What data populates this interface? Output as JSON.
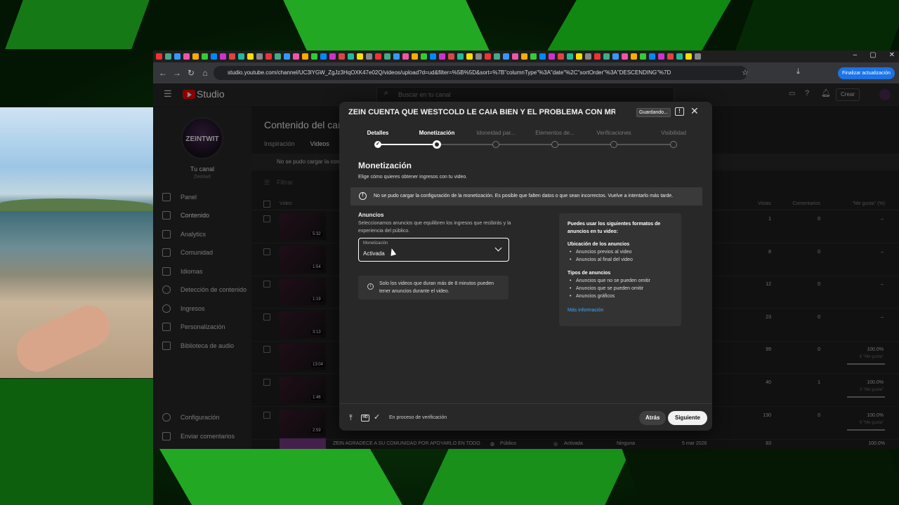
{
  "browser": {
    "url": "studio.youtube.com/channel/UC3lYGW_ZgJz3HqOXK47e02Q/videos/upload?d=ud&filter=%5B%5D&sort=%7B\"columnType\"%3A\"date\"%2C\"sortOrder\"%3A\"DESCENDING\"%7D",
    "update_button": "Finalizar actualización",
    "tab_colors": [
      "#e33",
      "#4a8",
      "#39f",
      "#e5a",
      "#fa0",
      "#3c3",
      "#08f",
      "#c3c",
      "#d44",
      "#2b9",
      "#fd0",
      "#888",
      "#e33",
      "#4a8",
      "#39f",
      "#e5a",
      "#fa0",
      "#3c3",
      "#08f",
      "#c3c",
      "#d44",
      "#2b9",
      "#fd0",
      "#888",
      "#e33",
      "#4a8",
      "#39f",
      "#e5a",
      "#fa0",
      "#3c3",
      "#08f",
      "#c3c",
      "#d44",
      "#2b9",
      "#fd0",
      "#888",
      "#e33",
      "#4a8",
      "#39f",
      "#e5a",
      "#fa0",
      "#3c3",
      "#08f",
      "#c3c",
      "#d44",
      "#2b9",
      "#fd0",
      "#888",
      "#e33",
      "#4a8",
      "#39f",
      "#e5a",
      "#fa0",
      "#3c3",
      "#08f",
      "#c3c",
      "#d44",
      "#2b9",
      "#fd0",
      "#888"
    ]
  },
  "studio": {
    "logo_text": "Studio",
    "search_placeholder": "Buscar en tu canal",
    "create_label": "Crear",
    "channel_label": "Tu canal",
    "channel_handle": "Zeintwit",
    "avatar_text": "ZEINTWIT",
    "nav": [
      "Panel",
      "Contenido",
      "Analytics",
      "Comunidad",
      "Idiomas",
      "Detección de contenido",
      "Ingresos",
      "Personalización",
      "Biblioteca de audio"
    ],
    "nav_bottom": [
      "Configuración",
      "Enviar comentarios"
    ],
    "page_title": "Contenido del canal",
    "tabs": [
      "Inspiración",
      "Videos"
    ],
    "banner": "No se pudo cargar la configuración",
    "filter_label": "Filtrar",
    "columns": {
      "video": "Video",
      "views": "Vistas",
      "comments": "Comentarios",
      "likes": "\"Me gusta\" (%)"
    },
    "rows": [
      {
        "dur": "5:32",
        "views": "1",
        "comments": "0",
        "likes": "–",
        "likes_sub": ""
      },
      {
        "dur": "1:54",
        "views": "8",
        "comments": "0",
        "likes": "–",
        "likes_sub": ""
      },
      {
        "dur": "1:19",
        "views": "12",
        "comments": "0",
        "likes": "–",
        "likes_sub": ""
      },
      {
        "dur": "3:13",
        "views": "23",
        "comments": "0",
        "likes": "–",
        "likes_sub": ""
      },
      {
        "dur": "13:04",
        "views": "99",
        "comments": "0",
        "likes": "100.0%",
        "likes_sub": "6 \"Me gusta\""
      },
      {
        "dur": "1:46",
        "views": "40",
        "comments": "1",
        "likes": "100.0%",
        "likes_sub": "3 \"Me gusta\""
      },
      {
        "dur": "2:59",
        "views": "130",
        "comments": "0",
        "likes": "100.0%",
        "likes_sub": "9 \"Me gusta\""
      }
    ],
    "last_row": {
      "title": "ZEIN AGRADECE A SU COMUNIDAD POR APOYARLO EN TODO",
      "visibility": "Público",
      "monetization": "Activada",
      "restrictions": "Ninguna",
      "date": "5 mar 2026",
      "views": "83",
      "likes": "100.0%"
    }
  },
  "modal": {
    "title": "ZEIN CUENTA QUE WESTCOLD LE CAIA BIEN Y EL PROBLEMA CON MR S...",
    "saving": "Guardando...",
    "steps": [
      "Detalles",
      "Monetización",
      "Idoneidad par...",
      "Elementos de...",
      "Verificaciones",
      "Visibilidad"
    ],
    "heading": "Monetización",
    "subheading": "Elige cómo quieres obtener ingresos con tu video.",
    "warning": "No se pudo cargar la configuración de la monetización. Es posible que falten datos o que sean incorrectos. Vuelve a intentarlo más tarde.",
    "ads_title": "Anuncios",
    "ads_desc": "Seleccionamos anuncios que equilibren los ingresos que recibirás y la experiencia del público.",
    "select_label": "Monetización",
    "select_value": "Activada",
    "note": "Solo los videos que duran más de 8 minutos pueden tener anuncios durante el video.",
    "info": {
      "title": "Puedes usar los siguientes formatos de anuncios en tu video:",
      "placement_title": "Ubicación de los anuncios",
      "placement": [
        "Anuncios previos al video",
        "Anuncios al final del video"
      ],
      "types_title": "Tipos de anuncios",
      "types": [
        "Anuncios que no se pueden omitir",
        "Anuncios que se pueden omitir",
        "Anuncios gráficos"
      ],
      "more": "Más información"
    },
    "footer_status": "En proceso de verificación",
    "back": "Atrás",
    "next": "Siguiente"
  }
}
